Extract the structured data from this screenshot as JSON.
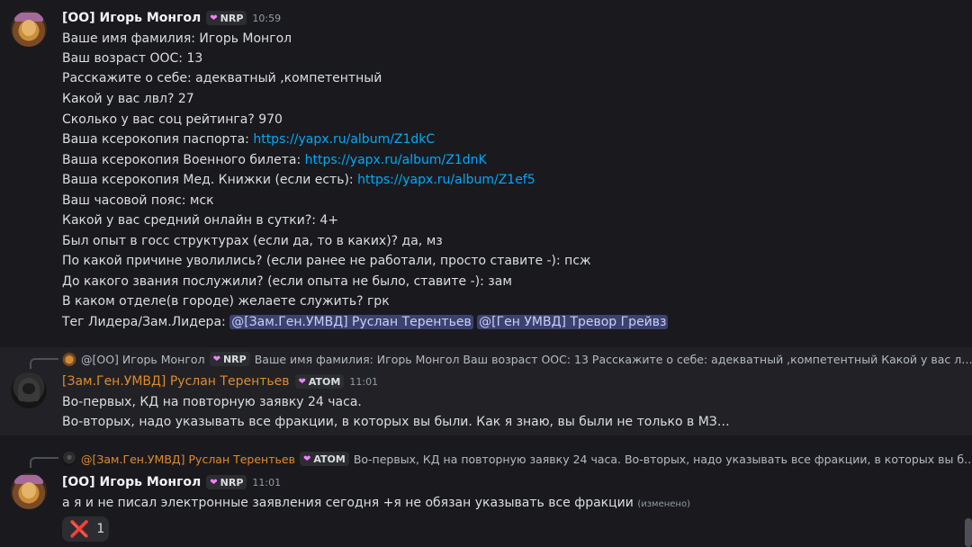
{
  "messages": [
    {
      "author": "[ОО] Игорь Монгол",
      "tag": "NRP",
      "time": "10:59",
      "lines": [
        {
          "label": "Ваше имя фамилия:  Игорь Монгол"
        },
        {
          "label": "Ваш возраст ООС:  13"
        },
        {
          "label": "Расскажите о себе:  адекватный ,компетентный"
        },
        {
          "label": "Какой у вас лвл? 27"
        },
        {
          "label": "Сколько у вас соц рейтинга? 970"
        },
        {
          "label": "Ваша ксерокопия паспорта: ",
          "link": "https://yapx.ru/album/Z1dkC"
        },
        {
          "label": "Ваша ксерокопия Военного билета: ",
          "link": "https://yapx.ru/album/Z1dnK"
        },
        {
          "label": "Ваша ксерокопия Мед. Книжки (если есть): ",
          "link": "https://yapx.ru/album/Z1ef5"
        },
        {
          "label": "Ваш часовой пояс:  мск"
        },
        {
          "label": "Какой у вас средний онлайн в сутки?: 4+"
        },
        {
          "label": "Был опыт в госс структурах (если да, то в каких)? да, мз"
        },
        {
          "label": "По какой причине уволились? (если ранее не работали, просто ставите -): псж"
        },
        {
          "label": "До какого звания послужили? (если опыта не было, ставите -): зам"
        },
        {
          "label": "В каком отделе(в городе) желаете служить? грк"
        },
        {
          "label": "Тег Лидера/Зам.Лидера:  "
        }
      ],
      "mentions": [
        "@[Зам.Ген.УМВД] Руслан Терентьев",
        "@[Ген УМВД] Тревор Грейвз"
      ]
    },
    {
      "reply": {
        "author": "@[ОО] Игорь Монгол",
        "tag": "NRP",
        "text": "Ваше имя фамилия:  Игорь Монгол Ваш возраст ООС:  13 Расскажите о себе:  адекватный ,компетентный Какой у вас л…"
      },
      "author": "[Зам.Ген.УМВД] Руслан Терентьев",
      "tag": "ATOM",
      "time": "11:01",
      "lines": [
        "Во-первых, КД на повторную заявку 24 часа.",
        "Во-вторых, надо указывать все фракции, в которых вы были. Как я знаю, вы были не только в МЗ…"
      ]
    },
    {
      "reply": {
        "author": "@[Зам.Ген.УМВД] Руслан Терентьев",
        "tag": "ATOM",
        "text": "Во-первых, КД на повторную заявку 24 часа. Во-вторых, надо указывать все фракции, в которых вы б…"
      },
      "author": "[ОО] Игорь Монгол",
      "tag": "NRP",
      "time": "11:01",
      "text": "а я и не писал электронные заявления сегодня +я не обязан указывать все фракции",
      "edited": "(изменено)",
      "reaction": {
        "emoji": "❌",
        "count": "1"
      }
    }
  ],
  "colors": {
    "background": "#1a1a1e",
    "link": "#00a8fc",
    "orange_role": "#e08a2c",
    "mention_bg": "#3c4270",
    "reaction_x": "#dd2e44"
  }
}
